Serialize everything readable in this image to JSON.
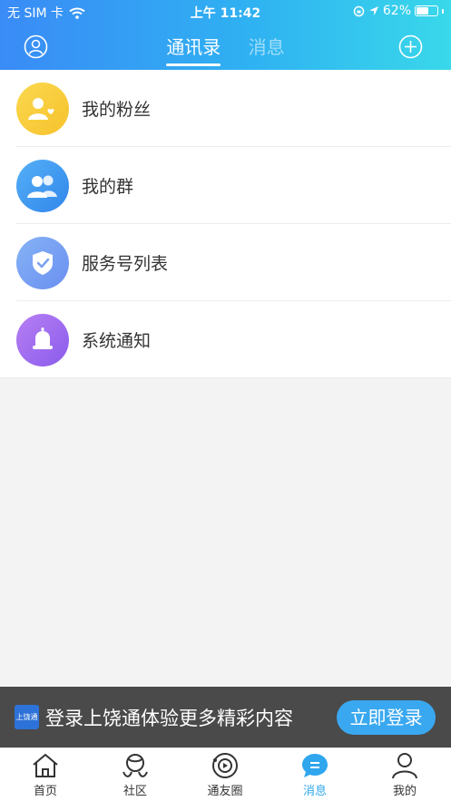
{
  "status_bar": {
    "carrier": "无 SIM 卡",
    "time": "上午 11:42",
    "battery_percent": "62%",
    "battery_level": 0.62
  },
  "nav": {
    "tabs": [
      {
        "label": "通讯录",
        "active": true
      },
      {
        "label": "消息",
        "active": false
      }
    ]
  },
  "list": {
    "items": [
      {
        "label": "我的粉丝",
        "icon": "fans-icon",
        "color": "#f9cf3c"
      },
      {
        "label": "我的群",
        "icon": "group-icon",
        "color": "#3d9cf0"
      },
      {
        "label": "服务号列表",
        "icon": "shield-check-icon",
        "color": "#6f9ff2"
      },
      {
        "label": "系统通知",
        "icon": "bell-icon",
        "color": "#a46ef0"
      }
    ]
  },
  "banner": {
    "logo_text": "上饶通",
    "text": "登录上饶通体验更多精彩内容",
    "button_label": "立即登录"
  },
  "tabbar": {
    "items": [
      {
        "label": "首页",
        "icon": "home-icon"
      },
      {
        "label": "社区",
        "icon": "community-icon"
      },
      {
        "label": "通友圈",
        "icon": "moments-icon"
      },
      {
        "label": "消息",
        "icon": "message-icon",
        "active": true
      },
      {
        "label": "我的",
        "icon": "profile-icon"
      }
    ]
  },
  "colors": {
    "header_start": "#3a8bf6",
    "header_end": "#39d8ea",
    "accent": "#2fa6ee"
  }
}
